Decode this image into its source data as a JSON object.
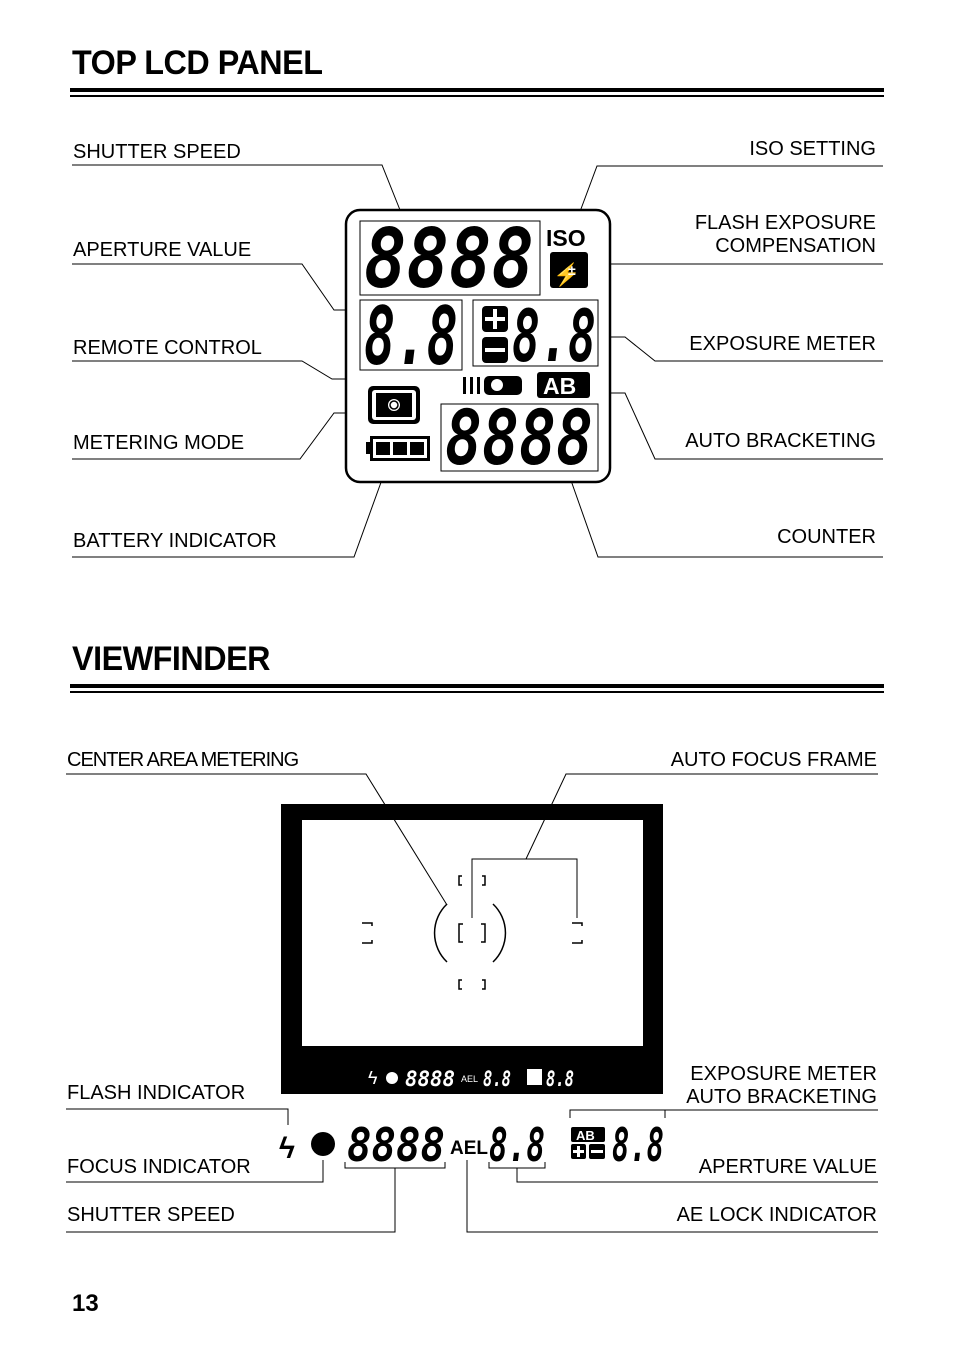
{
  "page_number": "13",
  "top_lcd": {
    "heading": "TOP LCD PANEL",
    "labels_left": [
      "SHUTTER SPEED",
      "APERTURE VALUE",
      "REMOTE CONTROL",
      "METERING MODE",
      "BATTERY INDICATOR"
    ],
    "labels_right": [
      "ISO  SETTING",
      "FLASH EXPOSURE",
      "COMPENSATION",
      "EXPOSURE METER",
      "AUTO BRACKETING",
      "COUNTER"
    ],
    "display": {
      "shutter_digits": "8888",
      "aperture_digits": "8.8",
      "exposure_digits": "8.8",
      "counter_digits": "8888",
      "iso_text": "ISO",
      "ab_text": "AB"
    }
  },
  "viewfinder": {
    "heading": "VIEWFINDER",
    "labels_left": [
      "CENTER AREA METERING",
      "FLASH INDICATOR",
      "FOCUS INDICATOR",
      "SHUTTER SPEED"
    ],
    "labels_right": [
      "AUTO FOCUS FRAME",
      "EXPOSURE METER",
      "AUTO BRACKETING",
      "APERTURE VALUE",
      "AE LOCK INDICATOR"
    ],
    "display": {
      "shutter_digits": "8888",
      "ael_text": "AEL",
      "aperture_digits": "8.8",
      "meter_digits": "8.8",
      "ab_text": "AB"
    }
  }
}
